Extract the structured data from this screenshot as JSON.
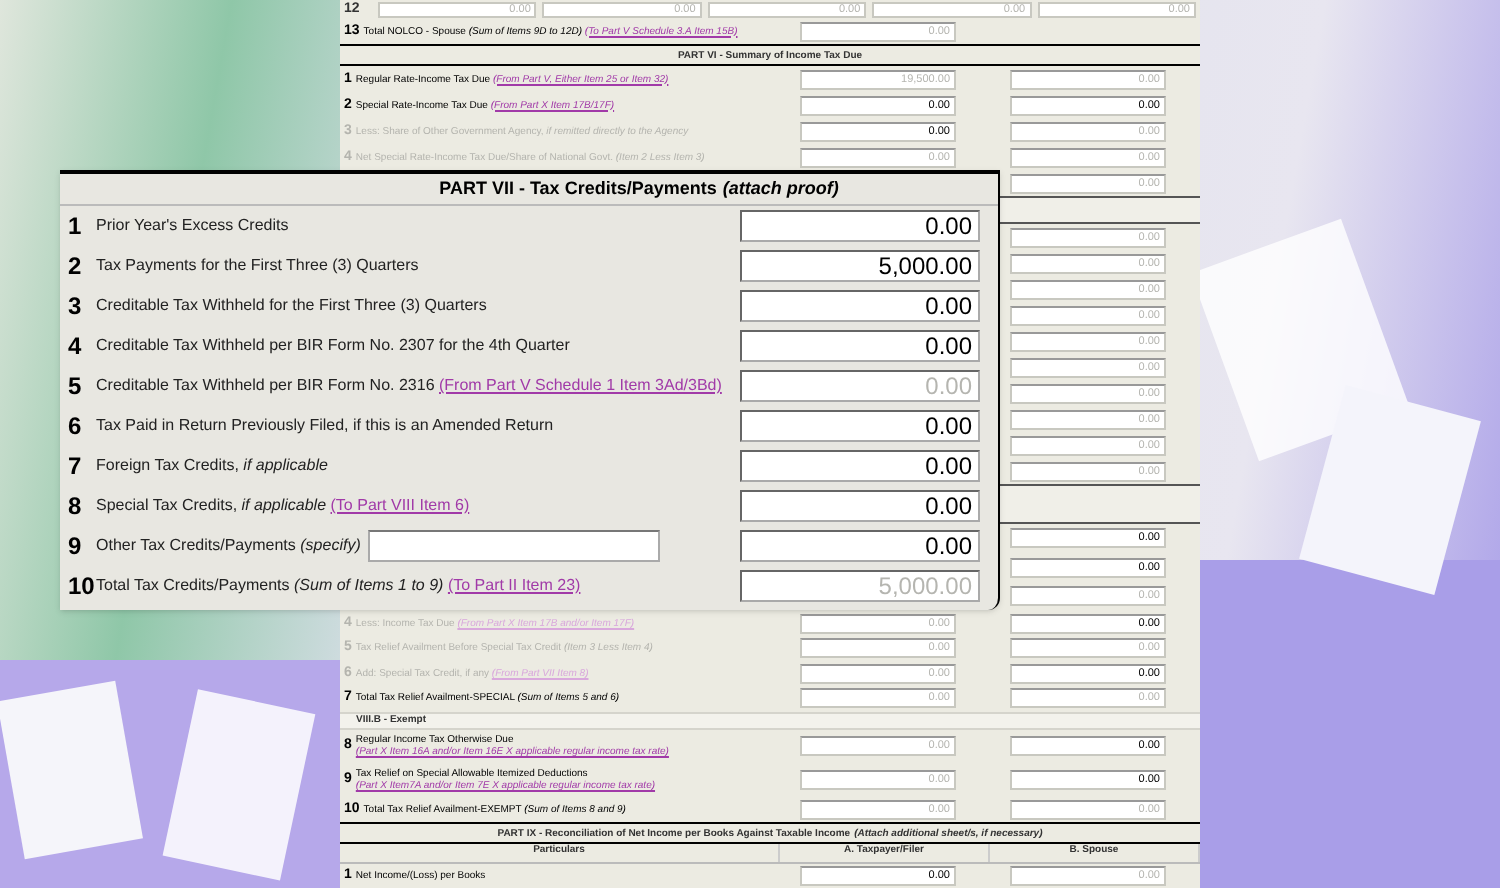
{
  "background_form": {
    "items": [
      {
        "kind": "multi",
        "number": "12",
        "fields": [
          {
            "value": "0.00",
            "disabled": true
          },
          {
            "value": "0.00",
            "disabled": true
          },
          {
            "value": "0.00",
            "disabled": true
          },
          {
            "value": "0.00",
            "disabled": true
          },
          {
            "value": "0.00",
            "disabled": true
          }
        ]
      },
      {
        "kind": "row",
        "number": "13",
        "label": "Total NOLCO - Spouse *(Sum of Items 9D to 12D)*",
        "link": "(To Part V Schedule 3.A Item 15B)",
        "muted": false,
        "a": {
          "value": "0.00",
          "disabled": true
        }
      },
      {
        "kind": "header",
        "title": "PART VI - Summary of Income Tax Due"
      },
      {
        "kind": "row",
        "number": "1",
        "label": "Regular Rate-Income Tax Due",
        "link": "(From Part V, Either Item 25 or Item 32)",
        "muted": false,
        "a": {
          "value": "19,500.00",
          "disabled": true
        },
        "b": {
          "value": "0.00",
          "disabled": true
        }
      },
      {
        "kind": "row",
        "number": "2",
        "label": "Special Rate-Income Tax Due",
        "link": "(From Part X Item 17B/17F)",
        "muted": false,
        "a": {
          "value": "0.00",
          "disabled": false
        },
        "b": {
          "value": "0.00",
          "disabled": false
        }
      },
      {
        "kind": "row",
        "number": "3",
        "label": "Less: Share of Other Government Agency, *if remitted directly to the Agency*",
        "muted": true,
        "a": {
          "value": "0.00",
          "disabled": false
        },
        "b": {
          "value": "0.00",
          "disabled": true
        }
      },
      {
        "kind": "row",
        "number": "4",
        "label": "Net Special Rate-Income Tax Due/Share of National Govt. *(Item 2 Less Item 3)*",
        "muted": true,
        "a": {
          "value": "0.00",
          "disabled": true
        },
        "b": {
          "value": "0.00",
          "disabled": true
        }
      },
      {
        "kind": "row",
        "b": {
          "value": "0.00",
          "disabled": true
        }
      },
      {
        "kind": "band"
      },
      {
        "kind": "row",
        "b": {
          "value": "0.00",
          "disabled": true
        }
      },
      {
        "kind": "row",
        "b": {
          "value": "0.00",
          "disabled": true
        }
      },
      {
        "kind": "row",
        "b": {
          "value": "0.00",
          "disabled": true
        }
      },
      {
        "kind": "row",
        "b": {
          "value": "0.00",
          "disabled": true
        }
      },
      {
        "kind": "row",
        "b": {
          "value": "0.00",
          "disabled": true
        }
      },
      {
        "kind": "row",
        "b": {
          "value": "0.00",
          "disabled": true
        }
      },
      {
        "kind": "row",
        "b": {
          "value": "0.00",
          "disabled": true
        }
      },
      {
        "kind": "row",
        "b": {
          "value": "0.00",
          "disabled": true
        }
      },
      {
        "kind": "row",
        "b": {
          "value": "0.00",
          "disabled": true
        }
      },
      {
        "kind": "row",
        "b": {
          "value": "0.00",
          "disabled": true
        }
      },
      {
        "kind": "band"
      },
      {
        "kind": "row",
        "b": {
          "value": "0.00",
          "disabled": false
        }
      },
      {
        "kind": "row",
        "b": {
          "value": "0.00",
          "disabled": false
        }
      },
      {
        "kind": "row",
        "b": {
          "value": "0.00",
          "disabled": true
        }
      },
      {
        "kind": "row",
        "number": "4",
        "label": "Less: Income Tax Due",
        "link": "(From Part X Item 17B and/or Item 17F)",
        "muted": true,
        "a": {
          "value": "0.00",
          "disabled": true
        },
        "b": {
          "value": "0.00",
          "disabled": false
        }
      },
      {
        "kind": "row",
        "number": "5",
        "label": "Tax Relief Availment Before Special Tax Credit *(Item 3 Less Item 4)*",
        "muted": true,
        "a": {
          "value": "0.00",
          "disabled": true
        },
        "b": {
          "value": "0.00",
          "disabled": true
        }
      },
      {
        "kind": "row",
        "number": "6",
        "label": "Add: Special Tax Credit, if any",
        "link": "(From Part VII Item 8)",
        "muted": true,
        "a": {
          "value": "0.00",
          "disabled": true
        },
        "b": {
          "value": "0.00",
          "disabled": false
        }
      },
      {
        "kind": "row",
        "number": "7",
        "label": "Total Tax Relief Availment-SPECIAL *(Sum of Items 5 and 6)*",
        "muted": false,
        "a": {
          "value": "0.00",
          "disabled": true
        },
        "b": {
          "value": "0.00",
          "disabled": true
        }
      },
      {
        "kind": "subheader",
        "title": "VIII.B - Exempt"
      },
      {
        "kind": "row",
        "number": "8",
        "label": "Regular Income Tax Otherwise Due",
        "link": "(Part X Item 16A and/or Item 16E X applicable regular income tax rate)",
        "muted": false,
        "a": {
          "value": "0.00",
          "disabled": true
        },
        "b": {
          "value": "0.00",
          "disabled": false
        }
      },
      {
        "kind": "row",
        "number": "9",
        "label": "Tax Relief on Special Allowable Itemized Deductions",
        "link": "(Part X Item7A and/or Item 7E X applicable regular income tax rate)",
        "muted": false,
        "a": {
          "value": "0.00",
          "disabled": true
        },
        "b": {
          "value": "0.00",
          "disabled": false
        }
      },
      {
        "kind": "row",
        "number": "10",
        "label": "Total Tax Relief Availment-EXEMPT *(Sum of Items 8 and 9)*",
        "muted": false,
        "a": {
          "value": "0.00",
          "disabled": true
        },
        "b": {
          "value": "0.00",
          "disabled": true
        }
      },
      {
        "kind": "header",
        "title": "PART IX - Reconciliation of Net Income per Books Against Taxable Income",
        "note": "(Attach additional sheet/s, if necessary)"
      },
      {
        "kind": "columns",
        "columns": [
          "Particulars",
          "A. Taxpayer/Filer",
          "B. Spouse"
        ]
      },
      {
        "kind": "row",
        "number": "1",
        "label": "Net Income/(Loss) per Books",
        "muted": false,
        "a": {
          "value": "0.00",
          "disabled": false
        },
        "b": {
          "value": "0.00",
          "disabled": true
        }
      }
    ]
  },
  "part_vii": {
    "title": "PART VII - Tax Credits/Payments",
    "note": "(attach proof)",
    "rows": [
      {
        "number": "1",
        "label": "Prior Year's Excess Credits",
        "a": {
          "value": "0.00",
          "disabled": false
        }
      },
      {
        "number": "2",
        "label": "Tax Payments for the First Three (3) Quarters",
        "a": {
          "value": "5,000.00",
          "disabled": false
        }
      },
      {
        "number": "3",
        "label": "Creditable Tax Withheld for the First Three (3) Quarters",
        "a": {
          "value": "0.00",
          "disabled": false
        }
      },
      {
        "number": "4",
        "label": "Creditable Tax Withheld per BIR Form No. 2307 for the 4th Quarter",
        "a": {
          "value": "0.00",
          "disabled": false
        }
      },
      {
        "number": "5",
        "label": "Creditable Tax Withheld per BIR Form No. 2316",
        "link": "(From Part V Schedule 1 Item 3Ad/3Bd)",
        "a": {
          "value": "0.00",
          "disabled": true
        }
      },
      {
        "number": "6",
        "label": "Tax Paid in Return Previously Filed, if this is an Amended Return",
        "a": {
          "value": "0.00",
          "disabled": false
        }
      },
      {
        "number": "7",
        "label": "Foreign Tax Credits, *if applicable*",
        "a": {
          "value": "0.00",
          "disabled": false
        }
      },
      {
        "number": "8",
        "label": "Special Tax Credits, *if applicable*",
        "link": "(To Part VIII Item 6)",
        "a": {
          "value": "0.00",
          "disabled": false
        }
      },
      {
        "number": "9",
        "label": "Other Tax Credits/Payments *(specify)*",
        "specify": true,
        "a": {
          "value": "0.00",
          "disabled": false
        }
      },
      {
        "number": "10",
        "label": "Total Tax Credits/Payments *(Sum of Items 1 to 9)*",
        "link": "(To Part II Item 23)",
        "a": {
          "value": "5,000.00",
          "disabled": true
        }
      }
    ]
  }
}
